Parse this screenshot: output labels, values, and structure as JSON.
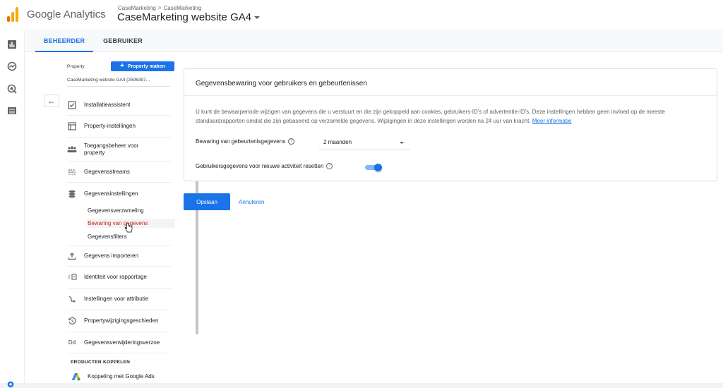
{
  "header": {
    "app_title": "Google Analytics",
    "breadcrumb": [
      "CaseMarketing",
      "CaseMarketing"
    ],
    "breadcrumb_sep": ">",
    "property_title": "CaseMarketing website GA4"
  },
  "tabs": [
    {
      "label": "BEHEERDER",
      "active": true
    },
    {
      "label": "GEBRUIKER",
      "active": false
    }
  ],
  "property_panel": {
    "label": "Property",
    "create_button": "Property maken",
    "property_name": "CaseMarketing website GA4 (2506397..."
  },
  "nav": {
    "items": [
      {
        "label": "Installatieassistent",
        "icon": "checkbox-icon"
      },
      {
        "label": "Property-instellingen",
        "icon": "window-icon"
      },
      {
        "label": "Toegangsbeheer voor",
        "label2": "property",
        "icon": "people-icon"
      },
      {
        "label": "Gegevensstreams",
        "icon": "streams-icon"
      },
      {
        "label": "Gegevensinstellingen",
        "icon": "database-icon"
      },
      {
        "label": "Gegevens importeren",
        "icon": "upload-icon"
      },
      {
        "label": "Identiteit voor rapportage",
        "icon": "identity-icon"
      },
      {
        "label": "Instellingen voor attributie",
        "icon": "attribution-icon"
      },
      {
        "label": "Propertywijzigingsgeschieden",
        "icon": "history-icon"
      },
      {
        "label": "Gegevensverwijderingsverzoe",
        "icon": "dd-icon",
        "icon_text": "Dd"
      },
      {
        "label": "Koppeling met Google Ads",
        "icon": "google-ads-icon"
      }
    ],
    "sub_items": [
      {
        "label": "Gegevensverzameling",
        "active": false
      },
      {
        "label": "Bewaring van gegevens",
        "active": true
      },
      {
        "label": "Gegevensfilters",
        "active": false
      }
    ],
    "section_heading": "PRODUCTEN KOPPELEN"
  },
  "card": {
    "title": "Gegevensbewaring voor gebruikers en gebeurtenissen",
    "description": "U kunt de bewaarperiode wijzigen van gegevens die u verstuurt en die zijn gekoppeld aan cookies, gebruikers-ID's of advertentie-ID's. Deze instellingen hebben geen invloed op de meeste standaardrapporten omdat die zijn gebaseerd op verzamelde gegevens. Wijzigingen in deze instellingen worden na 24 uur van kracht.",
    "learn_more": "Meer informatie",
    "retention_label": "Bewaring van gebeurtenisgegevens",
    "retention_value": "2 maanden",
    "reset_label": "Gebruikersgegevens voor nieuwe activiteit resetten",
    "reset_enabled": true,
    "help_glyph": "?"
  },
  "actions": {
    "save": "Opslaan",
    "cancel": "Annuleren"
  },
  "colors": {
    "accent": "#1a73e8",
    "active_sub_item": "#c5221f",
    "logo_orange": "#f9ab00",
    "logo_dark_orange": "#e37400"
  }
}
